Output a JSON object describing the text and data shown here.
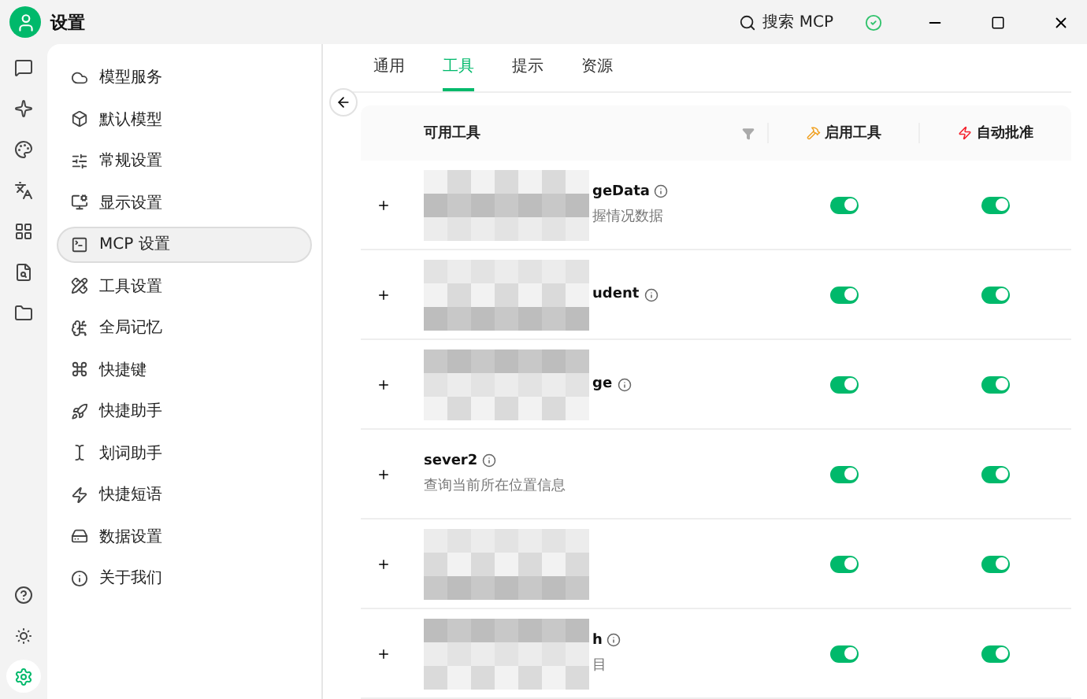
{
  "window": {
    "title": "设置",
    "search": "搜索 MCP"
  },
  "rail": [
    {
      "selected": false
    },
    {
      "selected": false
    },
    {
      "selected": false
    },
    {
      "selected": false
    },
    {
      "selected": false
    },
    {
      "selected": false
    },
    {
      "selected": false
    }
  ],
  "rail_bottom": [
    {
      "selected": false
    },
    {
      "selected": false
    },
    {
      "selected": true
    }
  ],
  "sidebar": {
    "items": [
      {
        "label": "模型服务",
        "selected": false
      },
      {
        "label": "默认模型",
        "selected": false
      },
      {
        "label": "常规设置",
        "selected": false
      },
      {
        "label": "显示设置",
        "selected": false
      },
      {
        "label": "MCP 设置",
        "selected": true
      },
      {
        "label": "工具设置",
        "selected": false
      },
      {
        "label": "全局记忆",
        "selected": false
      },
      {
        "label": "快捷键",
        "selected": false
      },
      {
        "label": "快捷助手",
        "selected": false
      },
      {
        "label": "划词助手",
        "selected": false
      },
      {
        "label": "快捷短语",
        "selected": false
      },
      {
        "label": "数据设置",
        "selected": false
      },
      {
        "label": "关于我们",
        "selected": false
      }
    ]
  },
  "tabs": [
    {
      "label": "通用",
      "selected": false
    },
    {
      "label": "工具",
      "selected": true
    },
    {
      "label": "提示",
      "selected": false
    },
    {
      "label": "资源",
      "selected": false
    }
  ],
  "table": {
    "columns": [
      "可用工具",
      "启用工具",
      "自动批准"
    ],
    "rows": [
      {
        "name": "geData",
        "description": "握情况数据",
        "redacted": true,
        "enabled": true,
        "auto_approve": true
      },
      {
        "name": "udent",
        "redacted": true,
        "enabled": true,
        "auto_approve": true
      },
      {
        "name": "ge",
        "redacted": true,
        "enabled": true,
        "auto_approve": true
      },
      {
        "name": "sever2",
        "description": "查询当前所在位置信息",
        "redacted": false,
        "enabled": true,
        "auto_approve": true
      },
      {
        "redacted": true,
        "enabled": true,
        "auto_approve": true
      },
      {
        "name": "h",
        "description": "目",
        "redacted": true,
        "enabled": true,
        "auto_approve": true
      }
    ]
  }
}
